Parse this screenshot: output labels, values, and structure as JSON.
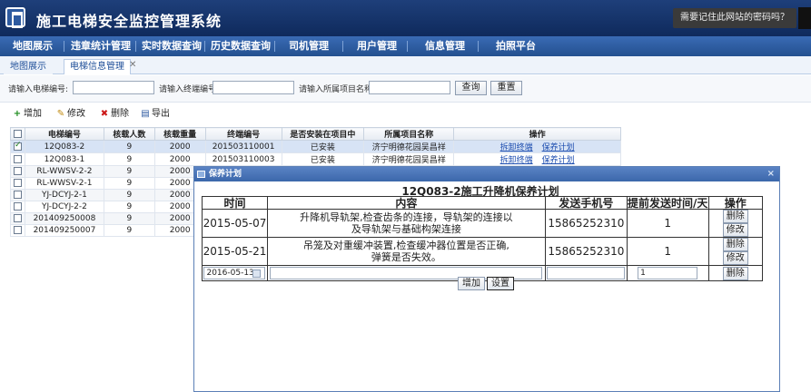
{
  "header": {
    "title": "施工电梯安全监控管理系统",
    "password_prompt": "需要记住此网站的密码吗？"
  },
  "nav": [
    "地图展示",
    "违章统计管理",
    "实时数据查询",
    "历史数据查询",
    "司机管理",
    "用户管理",
    "信息管理",
    "拍照平台"
  ],
  "tabs": [
    {
      "label": "地图展示",
      "active": false
    },
    {
      "label": "电梯信息管理",
      "active": true
    }
  ],
  "search": {
    "elevator_no_label": "请输入电梯编号:",
    "terminal_no_label": "请输入终端编号:",
    "project_label": "请输入所属项目名称:",
    "query_button": "查询",
    "reset_button": "重置"
  },
  "toolbar": {
    "add": "增加",
    "edit": "修改",
    "delete": "删除",
    "export": "导出"
  },
  "grid": {
    "columns": [
      "电梯编号",
      "核载人数",
      "核载重量",
      "终端编号",
      "是否安装在项目中",
      "所属项目名称",
      "操作"
    ],
    "rows": [
      {
        "checked": true,
        "id": "12Q083-2",
        "persons": "9",
        "weight": "2000",
        "terminal": "201503110001",
        "installed": "已安装",
        "project": "济宁明德花园吴昌祥",
        "actions": [
          "拆卸终端",
          "保养计划"
        ]
      },
      {
        "checked": false,
        "id": "12Q083-1",
        "persons": "9",
        "weight": "2000",
        "terminal": "201503110003",
        "installed": "已安装",
        "project": "济宁明德花园吴昌祥",
        "actions": [
          "拆卸终端",
          "保养计划"
        ]
      },
      {
        "checked": false,
        "id": "RL-WWSV-2-2",
        "persons": "9",
        "weight": "2000",
        "terminal": "",
        "installed": "",
        "project": "",
        "actions": []
      },
      {
        "checked": false,
        "id": "RL-WWSV-2-1",
        "persons": "9",
        "weight": "2000",
        "terminal": "",
        "installed": "",
        "project": "",
        "actions": []
      },
      {
        "checked": false,
        "id": "YJ-DCYJ-2-1",
        "persons": "9",
        "weight": "2000",
        "terminal": "",
        "installed": "",
        "project": "",
        "actions": []
      },
      {
        "checked": false,
        "id": "YJ-DCYJ-2-2",
        "persons": "9",
        "weight": "2000",
        "terminal": "",
        "installed": "",
        "project": "",
        "actions": []
      },
      {
        "checked": false,
        "id": "201409250008",
        "persons": "9",
        "weight": "2000",
        "terminal": "",
        "installed": "",
        "project": "",
        "actions": []
      },
      {
        "checked": false,
        "id": "201409250007",
        "persons": "9",
        "weight": "2000",
        "terminal": "",
        "installed": "",
        "project": "",
        "actions": []
      }
    ]
  },
  "dialog": {
    "title": "保养计划",
    "plan_title": "12Q083-2施工升降机保养计划",
    "columns": [
      "时间",
      "内容",
      "发送手机号",
      "提前发送时间/天",
      "操作"
    ],
    "rows": [
      {
        "date": "2015-05-07",
        "content_line1": "升降机导轨架,检查齿条的连接，导轨架的连接以",
        "content_line2": "及导轨架与基础构架连接",
        "phone": "15865252310",
        "days": "1",
        "delete": "删除",
        "edit": "修改"
      },
      {
        "date": "2015-05-21",
        "content_line1": "吊笼及对重缓冲装置,检查缓冲器位置是否正确,",
        "content_line2": "弹簧是否失效。",
        "phone": "15865252310",
        "days": "1",
        "delete": "删除",
        "edit": "修改"
      }
    ],
    "new_row": {
      "date": "2016-05-13",
      "content": "",
      "phone": "",
      "days": "1",
      "delete": "删除"
    },
    "add_button": "增加",
    "set_button": "设置"
  }
}
